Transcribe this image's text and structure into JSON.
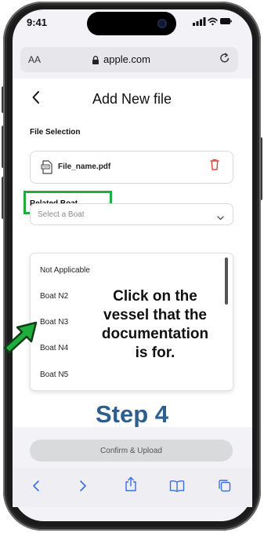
{
  "status_bar": {
    "time": "9:41"
  },
  "url_bar": {
    "text_size_label": "AA",
    "url": "apple.com"
  },
  "page": {
    "title": "Add New file",
    "file_section_label": "File Selection",
    "file_name": "File_name.pdf",
    "boat_section_label": "Related Boat",
    "boat_select_placeholder": "Select a Boat",
    "boat_options": [
      "Not Applicable",
      "Boat N2",
      "Boat N3",
      "Boat N4",
      "Boat N5"
    ],
    "confirm_label": "Confirm & Upload"
  },
  "overlay": {
    "instruction_lines": [
      "Click on the",
      "vessel that the",
      "documentation",
      "is for."
    ],
    "step_label": "Step 4"
  },
  "colors": {
    "highlight": "#1fad3c",
    "arrow": "#1fad3c",
    "step_text": "#2d5f8e",
    "trash": "#e0403a"
  },
  "icons": [
    "back-chevron-icon",
    "lock-icon",
    "reload-icon",
    "file-icon",
    "trash-icon",
    "chevron-down-icon",
    "share-icon",
    "bookmarks-icon",
    "tabs-icon"
  ]
}
